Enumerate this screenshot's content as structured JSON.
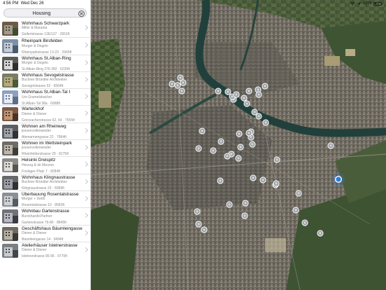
{
  "status": {
    "time": "4:56 PM",
    "date": "Wed Dec 26",
    "battery": "28%",
    "battery_level": 0.28
  },
  "search": {
    "value": "Housing"
  },
  "items": [
    {
      "title": "Wohnhaus Schwarzpark",
      "architect": "Miller & Maranta",
      "address": "Gellertstrasse 136/137 · 2651ft"
    },
    {
      "title": "Rheinpark Birsfelden",
      "architect": "Morger & Degelo",
      "address": "Rheinparkstrasse 13-23 · 2965ft"
    },
    {
      "title": "Wohnhaus St.Alban-Ring",
      "architect": "Morger & Degelo",
      "address": "St.Alban-Ring 276-282 · 6220ft"
    },
    {
      "title": "Wohnhaus Sevogelstrasse",
      "architect": "Buchner Bründler Architekten",
      "address": "Sevogelstrasse 52 · 6564ft"
    },
    {
      "title": "Wohnhaus St.Alban-Tal I",
      "architect": "Urs Gramelsbacher",
      "address": "St.Alban-Tal 38a · 6968ft"
    },
    {
      "title": "Warteckhof",
      "architect": "Diener & Diener",
      "address": "Grenzacherstrasse 62, 64 · 7555ft"
    },
    {
      "title": "Wohnen am Rheinweg",
      "architect": "jessenvollenweider",
      "address": "Alemannengasse 22 · 7864ft"
    },
    {
      "title": "Wohnen im Wettsteinpark",
      "architect": "jessenvollenweider",
      "address": "Rheinfelderstrasse 29 · 8175ft"
    },
    {
      "title": "Helsinki Dreispitz",
      "architect": "Herzog & de Meuron",
      "address": "Freilager-Platz 7 · 8284ft"
    },
    {
      "title": "Wohnhaus Klingnaustrasse",
      "architect": "Buchner Bründler Architekten",
      "address": "Klingnaustrasse 23 · 8389ft"
    },
    {
      "title": "Überbauung Rosentalstrasse",
      "architect": "Morger + Dettli",
      "address": "Rosentalstrasse 10 · 8582ft"
    },
    {
      "title": "Wohnbau Gartenstrasse",
      "architect": "Burckhardt+Partner",
      "address": "Gartenstrasse 76-80 · 8845ft"
    },
    {
      "title": "Geschäftshaus Bäumleingasse",
      "architect": "Diener & Diener",
      "address": "Bäumleingasse 14 · 9494ft"
    },
    {
      "title": "Atelierhäuser Isteinerstrasse",
      "architect": "Diener & Diener",
      "address": "Isteinerstrasse 90-96 · 9770ft"
    }
  ],
  "colors": {
    "user_location": "#2a7de1",
    "map_water": "#223f3b",
    "map_urban": "#6f6a62"
  }
}
